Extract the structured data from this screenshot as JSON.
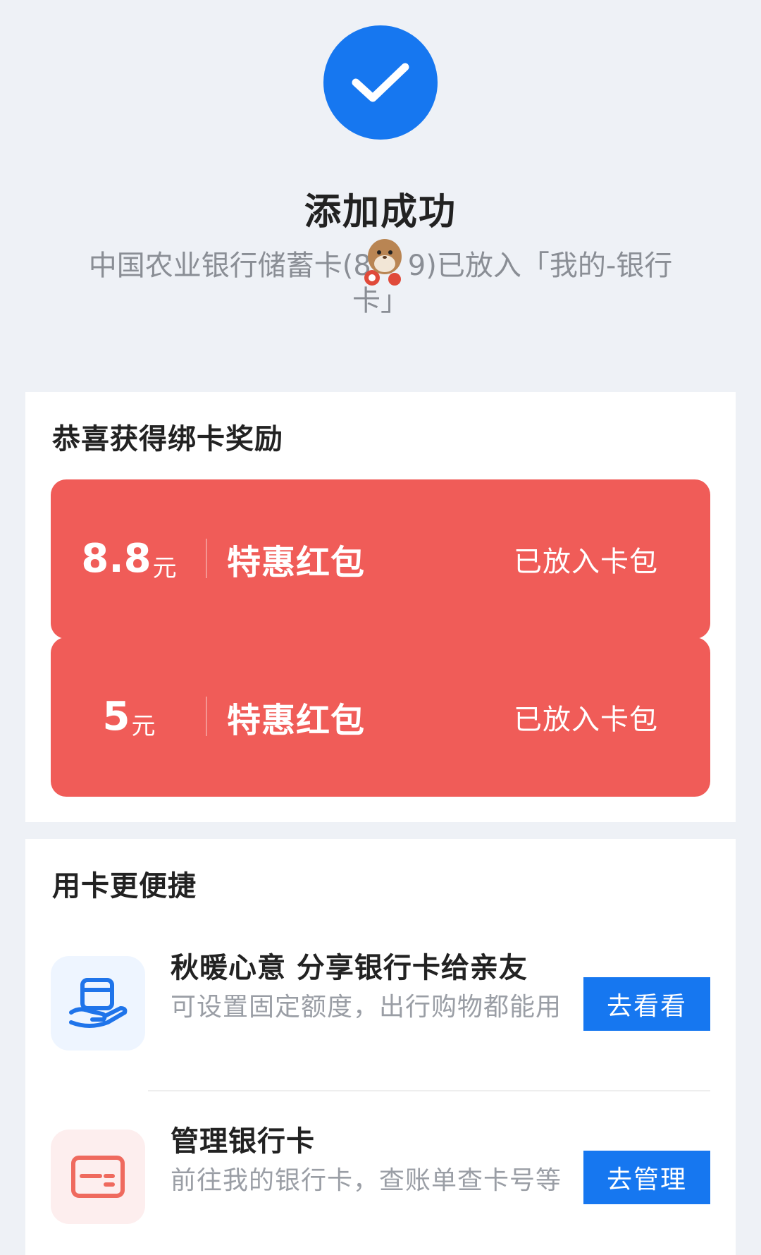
{
  "header": {
    "title": "添加成功",
    "desc_line1": "中国农业银行储蓄卡(8",
    "desc_line1_end": "9)已放入「我的-银行",
    "desc_line2": "卡」",
    "icon": "check-icon",
    "accent": "#1677f0"
  },
  "reward": {
    "title": "恭喜获得绑卡奖励",
    "packets": [
      {
        "amount": "8.8",
        "unit": "元",
        "name": "特惠红包",
        "status": "已放入卡包"
      },
      {
        "amount": "5",
        "unit": "元",
        "name": "特惠红包",
        "status": "已放入卡包"
      }
    ],
    "color": "#f05c58"
  },
  "convenience": {
    "title": "用卡更便捷",
    "items": [
      {
        "icon": "card-share-hand-icon",
        "title": "秋暖心意 分享银行卡给亲友",
        "desc": "可设置固定额度，出行购物都能用",
        "button": "去看看"
      },
      {
        "icon": "bank-card-icon",
        "title": "管理银行卡",
        "desc": "前往我的银行卡，查账单查卡号等",
        "button": "去管理"
      }
    ]
  }
}
